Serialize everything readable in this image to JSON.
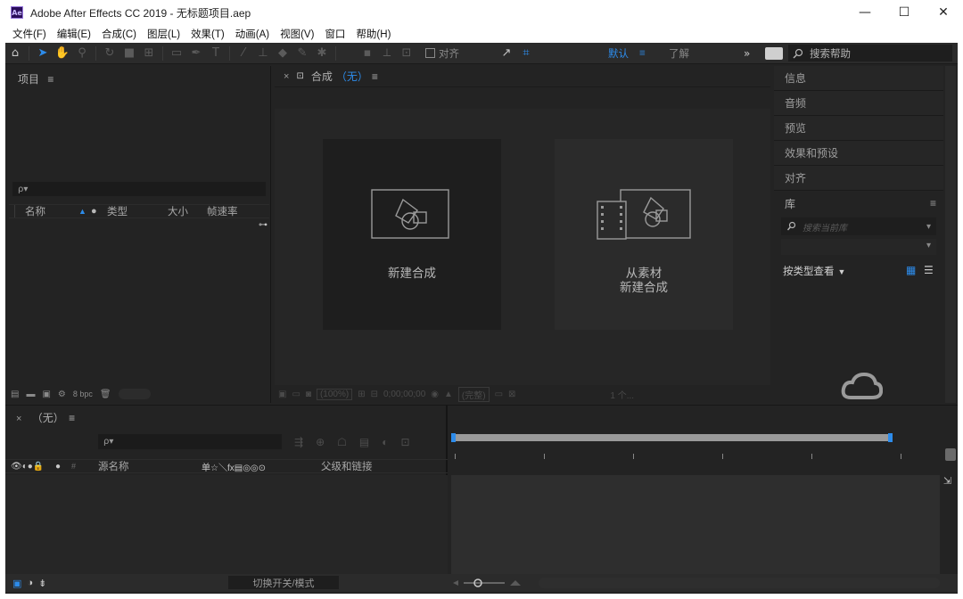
{
  "window": {
    "app_icon": "Ae",
    "title": "Adobe After Effects CC 2019 - 无标题项目.aep",
    "controls": {
      "minimize": "—",
      "maximize": "☐",
      "close": "✕"
    }
  },
  "menubar": {
    "items": [
      "文件(F)",
      "编辑(E)",
      "合成(C)",
      "图层(L)",
      "效果(T)",
      "动画(A)",
      "视图(V)",
      "窗口",
      "帮助(H)"
    ]
  },
  "toolbar": {
    "snap_label": "对齐",
    "workspace_default": "默认",
    "workspace_menu_icon": "≡",
    "workspace_learn": "了解",
    "more_icon": "»",
    "search_help_placeholder": "搜索帮助",
    "accent_color": "#2d8ceb"
  },
  "project_panel": {
    "title": "项目",
    "menu_icon": "≡",
    "search_icon": "ρ▾",
    "columns": [
      "名称",
      "类型",
      "大小",
      "帧速率"
    ],
    "bpc": "8 bpc"
  },
  "composition_panel": {
    "close_icon": "×",
    "lock_icon": "🔓",
    "title": "合成",
    "comp_name": "（无）",
    "menu_icon": "≡",
    "cards": [
      {
        "label_lines": [
          "新建合成"
        ],
        "icon": "new-composition-icon"
      },
      {
        "label_lines": [
          "从素材",
          "新建合成"
        ],
        "icon": "composition-from-footage-icon"
      }
    ],
    "footer": {
      "zoom": "(100%)",
      "timecode": "0;00;00;00",
      "resolution": "(完整)",
      "views": "1 个..."
    }
  },
  "right_panels": {
    "items": [
      "信息",
      "音频",
      "预览",
      "效果和预设",
      "对齐"
    ],
    "library": {
      "title": "库",
      "menu_icon": "≡",
      "search_placeholder": "搜索当前库",
      "view_by_type": "按类型查看",
      "cloud_icon": "creative-cloud-icon"
    }
  },
  "timeline": {
    "close_icon": "×",
    "comp_name": "（无）",
    "menu_icon": "≡",
    "search_icon": "ρ▾",
    "columns": {
      "source_name": "源名称",
      "switches": "单☆＼fx▤◎◎⊙",
      "parent_link": "父级和链接"
    },
    "toggle_modes": "切换开关/模式"
  }
}
